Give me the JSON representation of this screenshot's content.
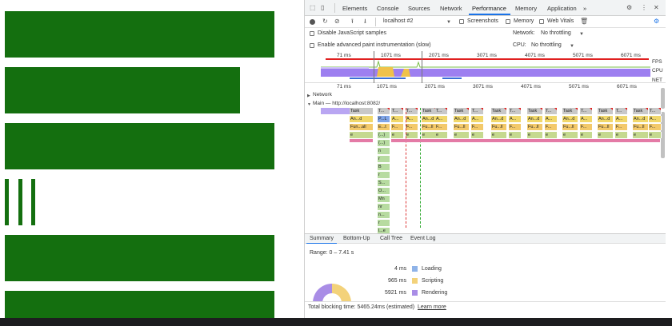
{
  "devtools": {
    "tabs": [
      "Elements",
      "Console",
      "Sources",
      "Network",
      "Performance",
      "Memory",
      "Application"
    ],
    "more_tabs": "»",
    "active_tab": "Performance"
  },
  "toolbar": {
    "target": "localhost #2",
    "screenshots_label": "Screenshots",
    "memory_label": "Memory",
    "web_vitals_label": "Web Vitals"
  },
  "settings": {
    "disable_js_samples": "Disable JavaScript samples",
    "advanced_paint": "Enable advanced paint instrumentation (slow)",
    "network_label": "Network:",
    "network_value": "No throttling",
    "cpu_label": "CPU:",
    "cpu_value": "No throttling"
  },
  "overview": {
    "ticks": [
      "71 ms",
      "1071 ms",
      "2071 ms",
      "3071 ms",
      "4071 ms",
      "5071 ms",
      "6071 ms"
    ],
    "fps_label": "FPS",
    "cpu_label": "CPU",
    "net_label": "NET"
  },
  "flame": {
    "ticks": [
      "71 ms",
      "1071 ms",
      "2071 ms",
      "3071 ms",
      "4071 ms",
      "5071 ms",
      "6071 ms"
    ],
    "network_track": "Network",
    "main_track": "Main — http://localhost:8082/",
    "task_label": "Task",
    "anim_label": "An...d",
    "func_label": "Fun...all",
    "eval_label": "e",
    "col_labels": [
      "T...",
      "A...",
      "F...",
      "e"
    ],
    "wide_anim": "An...d",
    "wide_func": "Fu...ll",
    "stack_labels": [
      "(...)",
      "(...)",
      "n",
      "r",
      "B",
      "r",
      "S...",
      "O...",
      "Mn",
      "nr",
      "n...",
      "r",
      "l...e"
    ],
    "blue_label": "P...L",
    "blue_label2": "E...t"
  },
  "bottom_tabs": [
    "Summary",
    "Bottom-Up",
    "Call Tree",
    "Event Log"
  ],
  "summary": {
    "range": "Range: 0 – 7.41 s",
    "rows": [
      {
        "value": "4 ms",
        "label": "Loading",
        "color": "#8fb3e8"
      },
      {
        "value": "965 ms",
        "label": "Scripting",
        "color": "#f3d27a"
      },
      {
        "value": "5921 ms",
        "label": "Rendering",
        "color": "#a98de6"
      }
    ]
  },
  "status": {
    "text": "Total blocking time: 5465.24ms (estimated)",
    "link": "Learn more"
  },
  "colors": {
    "green": "#146f0f",
    "accent": "#1a73e8"
  }
}
